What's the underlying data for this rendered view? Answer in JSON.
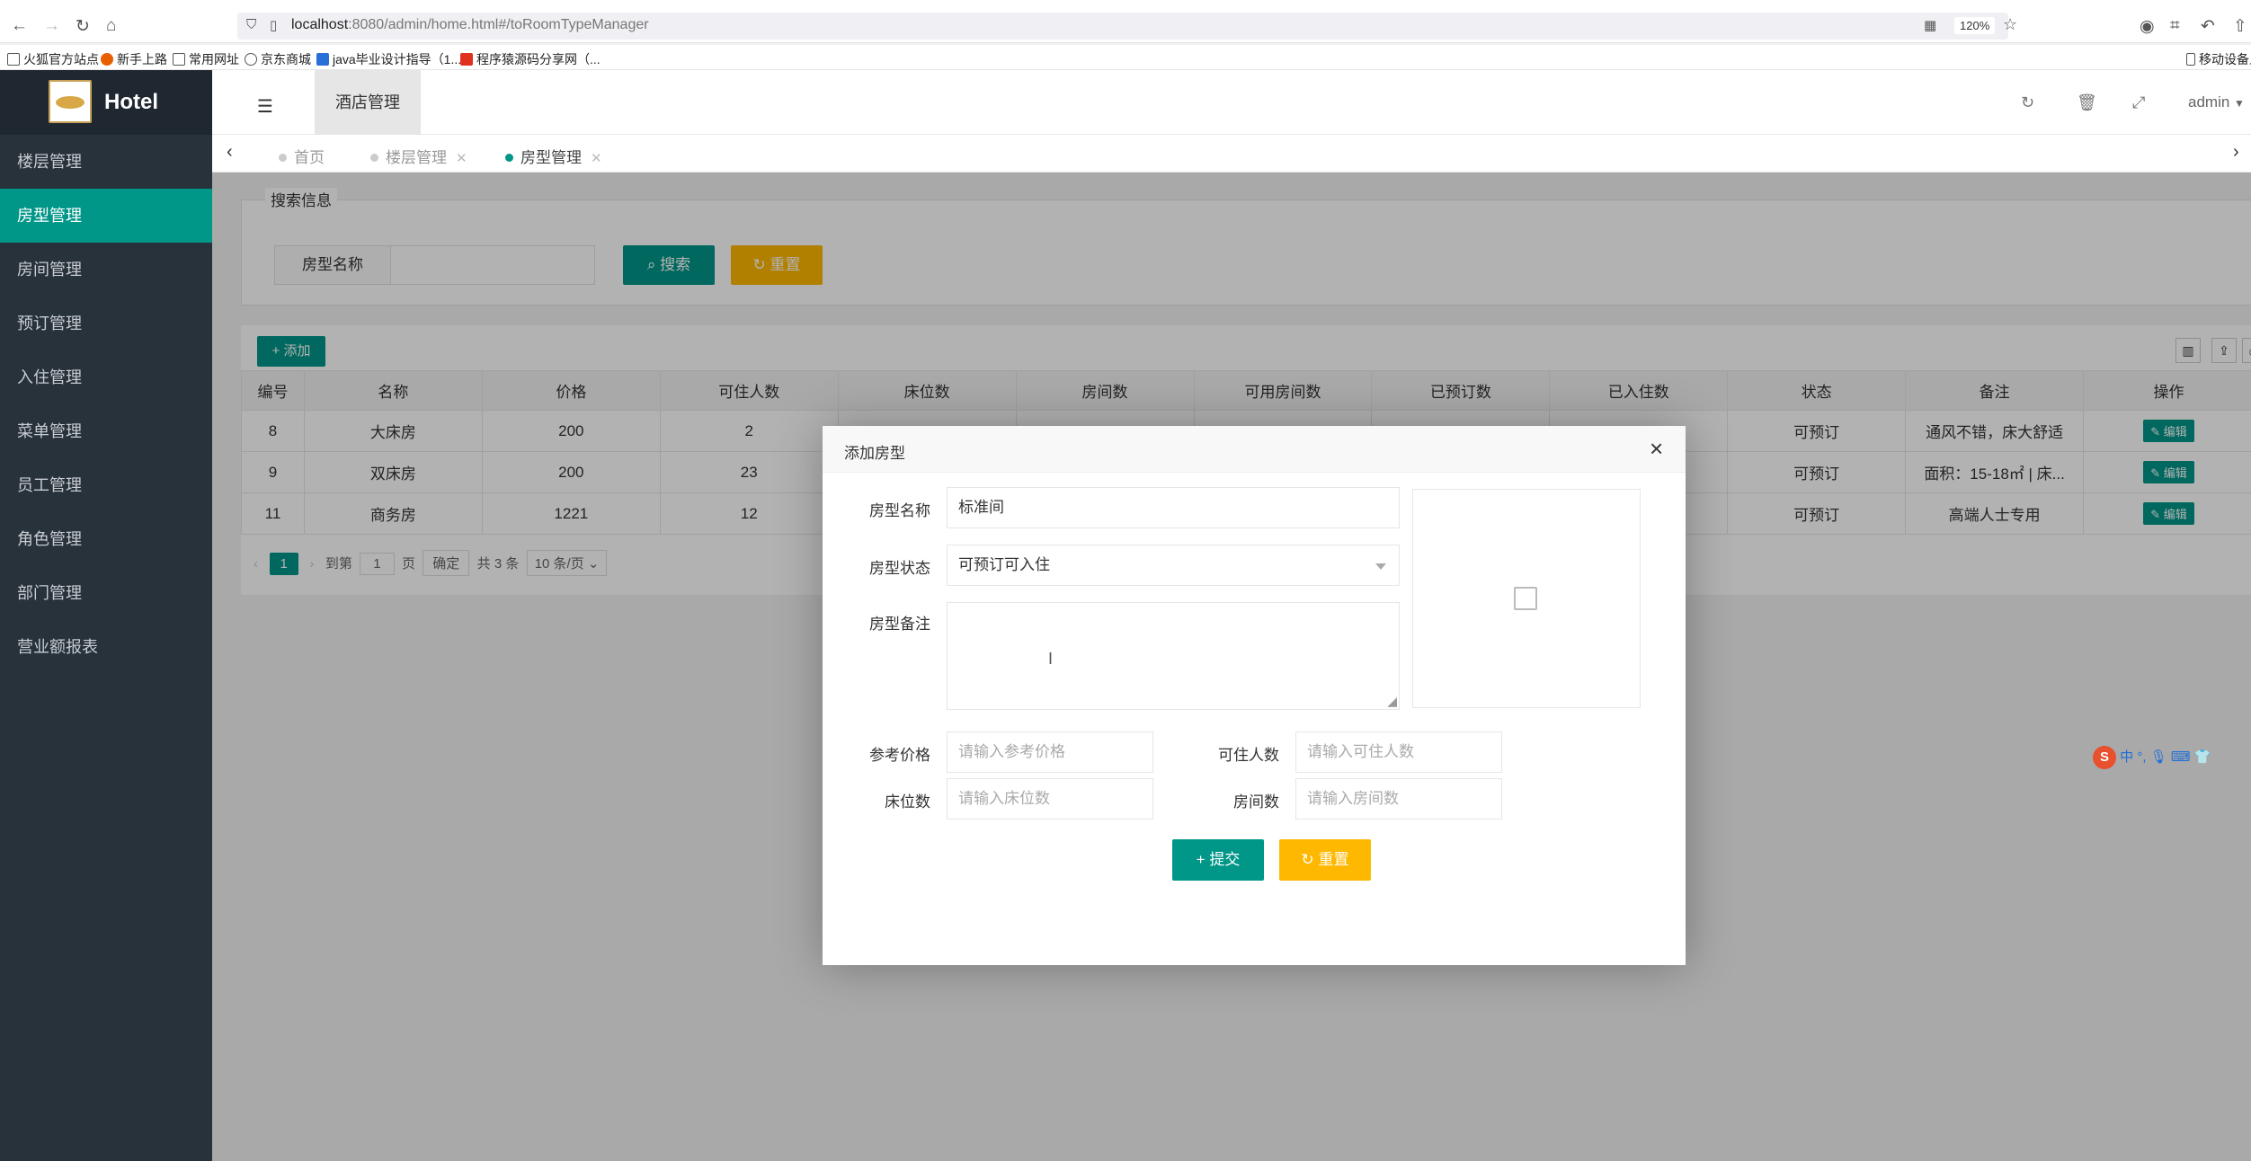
{
  "browser": {
    "url_host": "localhost",
    "url_rest": ":8080/admin/home.html#/toRoomTypeManager",
    "zoom": "120%",
    "bookmarks": [
      "火狐官方站点",
      "新手上路",
      "常用网址",
      "京东商城",
      "java毕业设计指导（1...",
      "程序猿源码分享网（..."
    ],
    "bookmark_right": "移动设备上"
  },
  "sidebar": {
    "logo_text": "Hotel",
    "items": [
      {
        "label": "楼层管理"
      },
      {
        "label": "房型管理",
        "active": true
      },
      {
        "label": "房间管理"
      },
      {
        "label": "预订管理"
      },
      {
        "label": "入住管理"
      },
      {
        "label": "菜单管理"
      },
      {
        "label": "员工管理"
      },
      {
        "label": "角色管理"
      },
      {
        "label": "部门管理"
      },
      {
        "label": "营业额报表"
      }
    ]
  },
  "header": {
    "tab": "酒店管理",
    "user": "admin"
  },
  "tabs": [
    {
      "label": "首页"
    },
    {
      "label": "楼层管理"
    },
    {
      "label": "房型管理",
      "active": true
    }
  ],
  "search": {
    "legend": "搜索信息",
    "label": "房型名称",
    "search_btn": "搜索",
    "reset_btn": "重置"
  },
  "table": {
    "add_btn": "添加",
    "columns": [
      "编号",
      "名称",
      "价格",
      "可住人数",
      "床位数",
      "房间数",
      "可用房间数",
      "已预订数",
      "已入住数",
      "状态",
      "备注",
      "操作"
    ],
    "rows": [
      {
        "id": "8",
        "name": "大床房",
        "price": "200",
        "people": "2",
        "status": "可预订",
        "note": "通风不错，床大舒适",
        "action": "编辑"
      },
      {
        "id": "9",
        "name": "双床房",
        "price": "200",
        "people": "23",
        "status": "可预订",
        "note": "面积：15-18㎡ | 床...",
        "action": "编辑"
      },
      {
        "id": "11",
        "name": "商务房",
        "price": "1221",
        "people": "12",
        "status": "可预订",
        "note": "高端人士专用",
        "action": "编辑"
      }
    ],
    "pager": {
      "current": "1",
      "goto": "到第",
      "goto_value": "1",
      "page_unit": "页",
      "confirm": "确定",
      "total": "共 3 条",
      "per_page": "10 条/页"
    }
  },
  "modal": {
    "title": "添加房型",
    "name_label": "房型名称",
    "name_value": "标准间",
    "status_label": "房型状态",
    "status_value": "可预订可入住",
    "note_label": "房型备注",
    "price_label": "参考价格",
    "price_placeholder": "请输入参考价格",
    "people_label": "可住人数",
    "people_placeholder": "请输入可住人数",
    "bed_label": "床位数",
    "bed_placeholder": "请输入床位数",
    "room_label": "房间数",
    "room_placeholder": "请输入房间数",
    "submit_btn": "提交",
    "reset_btn": "重置"
  },
  "ime": {
    "chinese_mode": "中"
  },
  "colors": {
    "primary": "#009688",
    "warning": "#ffb800",
    "sidebar": "#28323b"
  }
}
